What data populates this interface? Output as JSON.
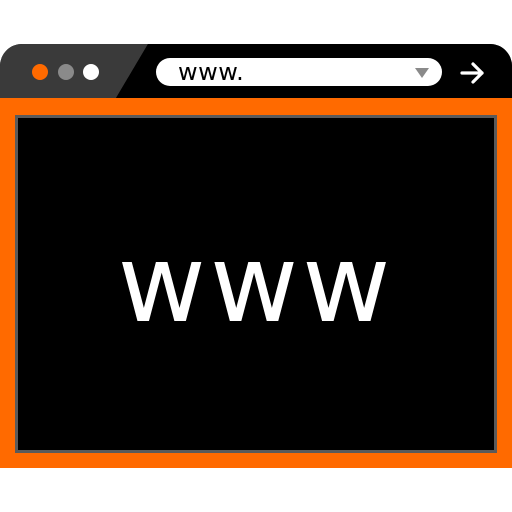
{
  "window": {
    "controls": [
      {
        "name": "close",
        "color": "#ff6a00"
      },
      {
        "name": "minimize",
        "color": "#8a8a8a"
      },
      {
        "name": "maximize",
        "color": "#ffffff"
      }
    ],
    "titlebar_colors": {
      "dark": "#000000",
      "light": "#3a3a3a"
    },
    "frame_color": "#ff6a00",
    "viewport_color": "#000000",
    "viewport_border_color": "#5a5a5a"
  },
  "address_bar": {
    "value": "www.",
    "dropdown_icon": "caret-down-icon"
  },
  "navigation": {
    "go_icon": "arrow-right-icon"
  },
  "page": {
    "heading": "www"
  }
}
